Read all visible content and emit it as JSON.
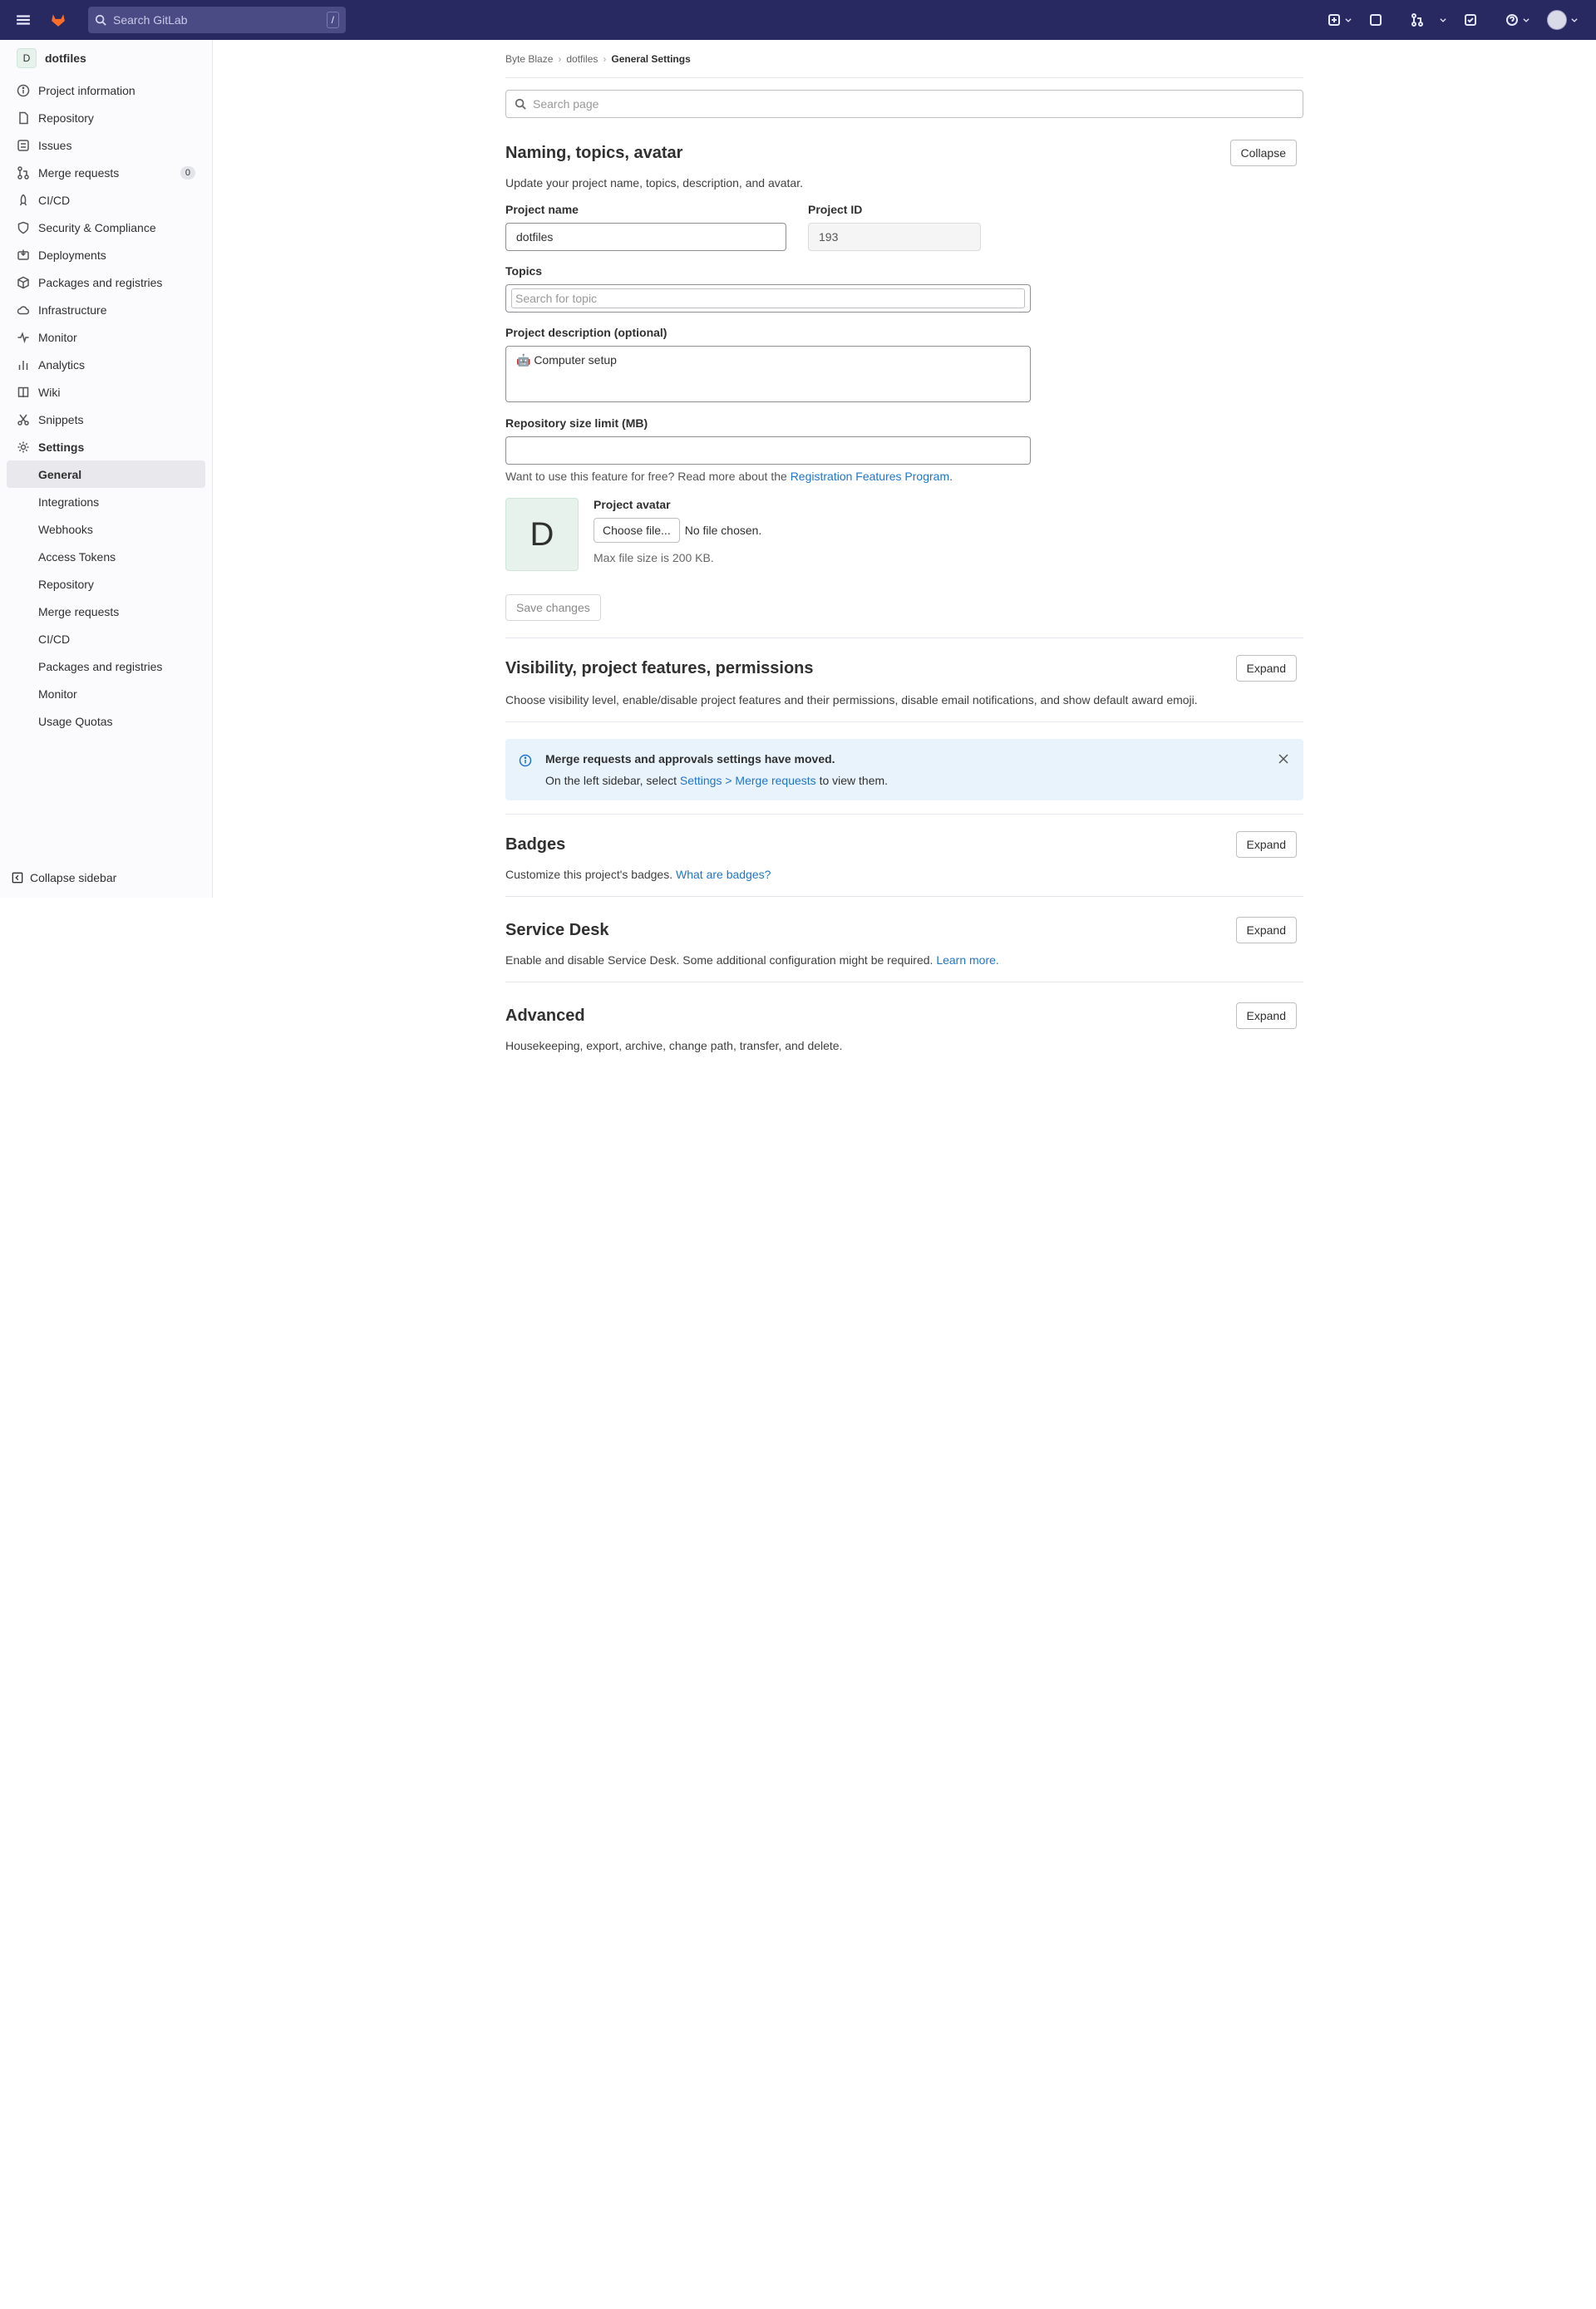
{
  "topbar": {
    "search_placeholder": "Search GitLab",
    "search_shortcut": "/",
    "issues_count": "",
    "mr_count": "",
    "todos_count": ""
  },
  "sidebar": {
    "project_initial": "D",
    "project_name": "dotfiles",
    "items": [
      {
        "label": "Project information",
        "icon": "info-icon"
      },
      {
        "label": "Repository",
        "icon": "doc-icon"
      },
      {
        "label": "Issues",
        "icon": "issues-icon"
      },
      {
        "label": "Merge requests",
        "icon": "merge-request-icon",
        "count": "0"
      },
      {
        "label": "CI/CD",
        "icon": "rocket-icon"
      },
      {
        "label": "Security & Compliance",
        "icon": "shield-icon"
      },
      {
        "label": "Deployments",
        "icon": "deployments-icon"
      },
      {
        "label": "Packages and registries",
        "icon": "package-icon"
      },
      {
        "label": "Infrastructure",
        "icon": "cloud-icon"
      },
      {
        "label": "Monitor",
        "icon": "monitor-icon"
      },
      {
        "label": "Analytics",
        "icon": "chart-icon"
      },
      {
        "label": "Wiki",
        "icon": "book-icon"
      },
      {
        "label": "Snippets",
        "icon": "snippet-icon"
      },
      {
        "label": "Settings",
        "icon": "gear-icon"
      }
    ],
    "settings_sub": [
      "General",
      "Integrations",
      "Webhooks",
      "Access Tokens",
      "Repository",
      "Merge requests",
      "CI/CD",
      "Packages and registries",
      "Monitor",
      "Usage Quotas"
    ],
    "collapse_label": "Collapse sidebar"
  },
  "breadcrumb": {
    "group": "Byte Blaze",
    "project": "dotfiles",
    "current": "General Settings"
  },
  "page_search_placeholder": "Search page",
  "naming": {
    "title": "Naming, topics, avatar",
    "collapse_label": "Collapse",
    "description": "Update your project name, topics, description, and avatar.",
    "project_name_label": "Project name",
    "project_name_value": "dotfiles",
    "project_id_label": "Project ID",
    "project_id_value": "193",
    "topics_label": "Topics",
    "topics_placeholder": "Search for topic",
    "description_label": "Project description (optional)",
    "description_value": "🤖 Computer setup",
    "size_limit_label": "Repository size limit (MB)",
    "size_limit_value": "",
    "free_feature_text": "Want to use this feature for free? Read more about the",
    "free_feature_link": "Registration Features Program",
    "free_feature_end": ".",
    "avatar_initial": "D",
    "avatar_label": "Project avatar",
    "choose_file_label": "Choose file...",
    "no_file_text": "No file chosen.",
    "max_size_text": "Max file size is 200 KB.",
    "save_label": "Save changes"
  },
  "visibility": {
    "title": "Visibility, project features, permissions",
    "expand_label": "Expand",
    "description": "Choose visibility level, enable/disable project features and their permissions, disable email notifications, and show default award emoji."
  },
  "alert": {
    "title": "Merge requests and approvals settings have moved.",
    "body_start": "On the left sidebar, select",
    "body_link": "Settings > Merge requests",
    "body_end": "to view them."
  },
  "badges": {
    "title": "Badges",
    "expand_label": "Expand",
    "description": "Customize this project's badges.",
    "link": "What are badges?"
  },
  "service_desk": {
    "title": "Service Desk",
    "expand_label": "Expand",
    "description": "Enable and disable Service Desk. Some additional configuration might be required.",
    "link": "Learn more."
  },
  "advanced": {
    "title": "Advanced",
    "expand_label": "Expand",
    "description": "Housekeeping, export, archive, change path, transfer, and delete."
  },
  "colors": {
    "topbar": "#292961",
    "link": "#1f75cb",
    "alert_bg": "#e9f3fc"
  }
}
